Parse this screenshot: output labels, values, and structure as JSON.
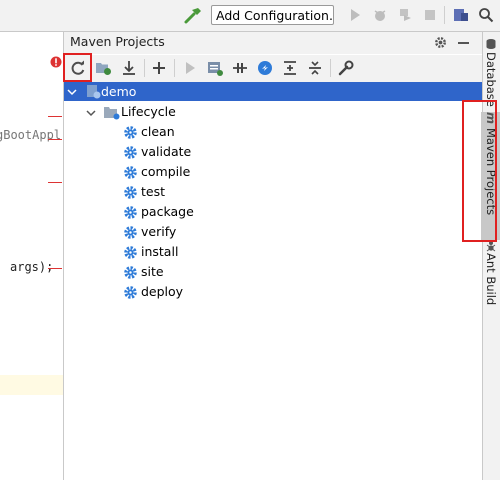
{
  "toolbar": {
    "run_config_label": "Add Configuration..."
  },
  "editor": {
    "code_line_1": "gBootAppl",
    "code_line_2": "args);"
  },
  "panel": {
    "title": "Maven Projects",
    "tree": {
      "project": "demo",
      "group": "Lifecycle",
      "phases": [
        "clean",
        "validate",
        "compile",
        "test",
        "package",
        "verify",
        "install",
        "site",
        "deploy"
      ]
    }
  },
  "right_strip": {
    "tabs": [
      "Database",
      "Maven Projects",
      "Ant Build"
    ]
  },
  "colors": {
    "selection": "#2f65ca",
    "annotation": "#e02020",
    "phase_icon": "#2e7bd8"
  }
}
